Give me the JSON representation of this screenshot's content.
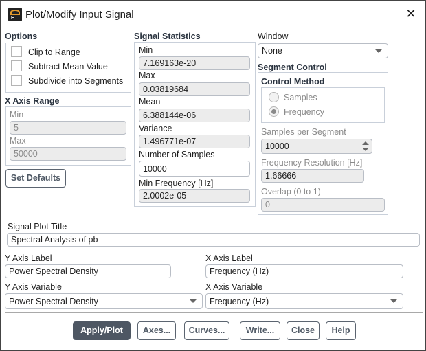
{
  "window": {
    "title": "Plot/Modify Input Signal",
    "app_icon": "fluent-app-icon",
    "close_icon": "close-icon"
  },
  "options": {
    "label": "Options",
    "items": [
      {
        "label": "Clip to Range",
        "checked": false
      },
      {
        "label": "Subtract Mean Value",
        "checked": false
      },
      {
        "label": "Subdivide into Segments",
        "checked": false
      }
    ]
  },
  "x_axis_range": {
    "label": "X Axis Range",
    "min_label": "Min",
    "min_value": "5",
    "max_label": "Max",
    "max_value": "50000"
  },
  "set_defaults": "Set Defaults",
  "signal_statistics": {
    "label": "Signal Statistics",
    "min_label": "Min",
    "min": "7.169163e-20",
    "max_label": "Max",
    "max": "0.03819684",
    "mean_label": "Mean",
    "mean": "6.388144e-06",
    "variance_label": "Variance",
    "variance": "1.496771e-07",
    "samples_label": "Number of Samples",
    "samples": "10000",
    "minfreq_label": "Min Frequency [Hz]",
    "minfreq": "2.0002e-05"
  },
  "window_select": {
    "label": "Window",
    "value": "None"
  },
  "segment_control": {
    "label": "Segment Control",
    "control_method": "Control Method",
    "radio_samples": "Samples",
    "radio_frequency": "Frequency",
    "selected": "Frequency",
    "sps_label": "Samples per Segment",
    "sps": "10000",
    "freqres_label": "Frequency Resolution [Hz]",
    "freqres": "1.66666",
    "overlap_label": "Overlap (0 to 1)",
    "overlap": "0"
  },
  "plot_title": {
    "label": "Signal Plot Title",
    "value": "Spectral Analysis of pb"
  },
  "y_axis_label": {
    "label": "Y Axis Label",
    "value": "Power Spectral Density"
  },
  "x_axis_label": {
    "label": "X Axis Label",
    "value": "Frequency (Hz)"
  },
  "y_axis_variable": {
    "label": "Y Axis Variable",
    "value": "Power Spectral Density"
  },
  "x_axis_variable": {
    "label": "X Axis Variable",
    "value": "Frequency (Hz)"
  },
  "buttons": {
    "apply": "Apply/Plot",
    "axes": "Axes...",
    "curves": "Curves...",
    "write": "Write...",
    "close": "Close",
    "help": "Help"
  }
}
